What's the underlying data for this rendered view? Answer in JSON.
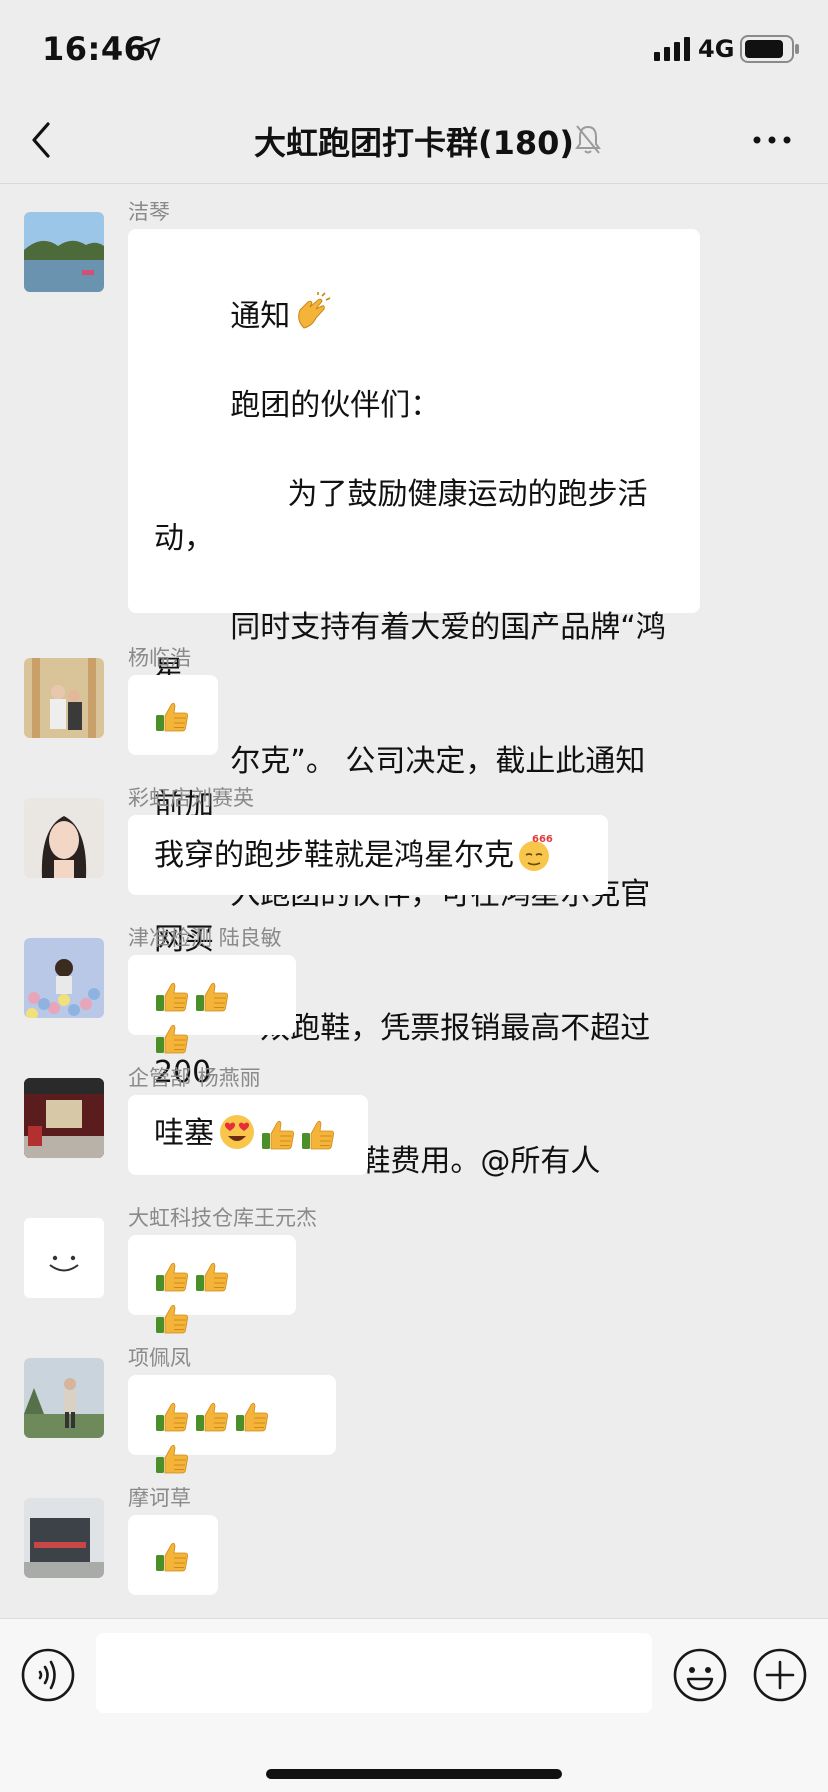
{
  "status": {
    "time": "16:46",
    "network": "4G"
  },
  "nav": {
    "title": "大虹跑团打卡群(180)"
  },
  "messages": [
    {
      "sender": "洁琴",
      "avatar_icon": "lake-landscape-photo",
      "text_lines": [
        "通知",
        "跑团的伙伴们：",
        "      为了鼓励健康运动的跑步活动，",
        "同时支持有着大爱的国产品牌“鸿星",
        "尔克”。 公司决定，截止此通知前加",
        "入跑团的伙伴，可在鸿星尔克官网买",
        "一双跑鞋，凭票报销最高不超过200",
        "元/人的购鞋费用。@所有人"
      ],
      "emoji_after_first": "clapping-hands-icon"
    },
    {
      "sender": "杨临浩",
      "avatar_icon": "wedding-photo",
      "thumbs": 1
    },
    {
      "sender": "彩虹店刘赛英",
      "avatar_icon": "woman-portrait-photo",
      "text": "我穿的跑步鞋就是鸿星尔克",
      "emoji": "666-face-icon"
    },
    {
      "sender": "津准检测 陆良敏",
      "avatar_icon": "ball-pit-photo",
      "thumbs": 3
    },
    {
      "sender": "企管部 杨燕丽",
      "avatar_icon": "showroom-photo",
      "text": "哇塞",
      "thumbs": 2,
      "emoji": "heart-eyes-icon"
    },
    {
      "sender": "大虹科技仓库王元杰",
      "avatar_icon": "smile-face-icon",
      "thumbs": 3
    },
    {
      "sender": "项佩凤",
      "avatar_icon": "outdoor-person-photo",
      "thumbs": 4
    },
    {
      "sender": "摩诃草",
      "avatar_icon": "building-photo",
      "thumbs": 1
    }
  ],
  "input": {
    "placeholder": ""
  },
  "colors": {
    "background": "#ededed",
    "bubble": "#ffffff",
    "sender_gray": "#8a8a8a"
  }
}
